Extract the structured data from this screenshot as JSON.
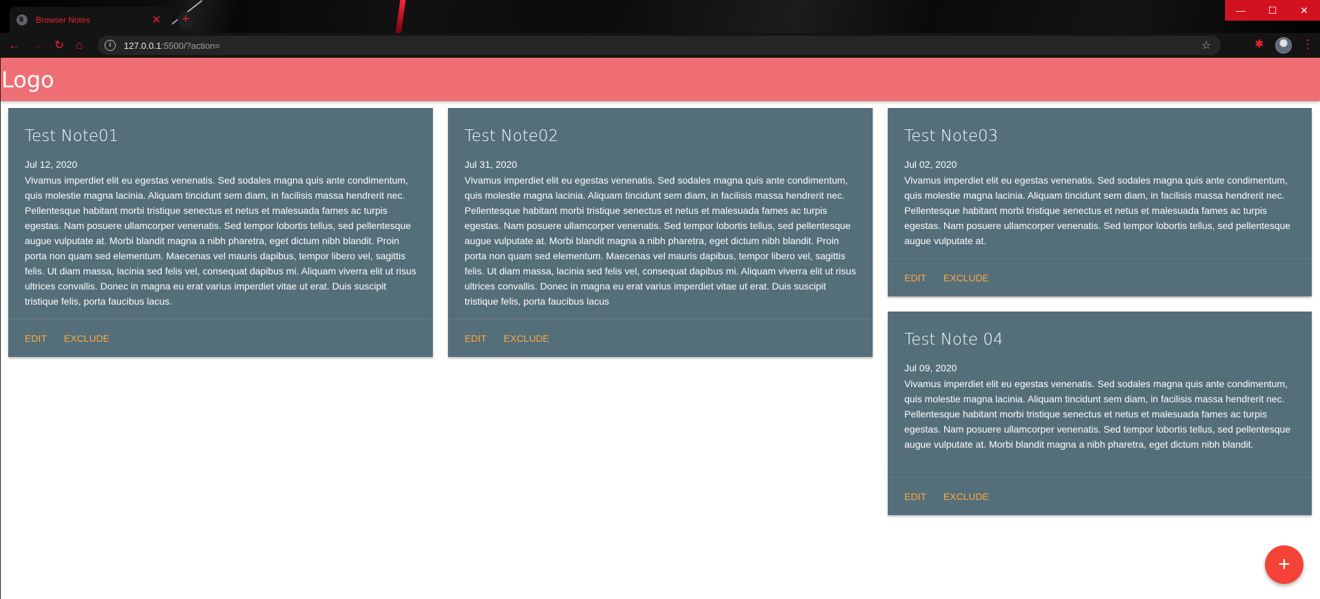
{
  "browser": {
    "tab_title": "Browser Notes",
    "tab_close": "✕",
    "new_tab": "+",
    "url_host": "127.0.0.1",
    "url_rest": ":5500/?action=",
    "window_controls": [
      "—",
      "☐",
      "✕"
    ]
  },
  "header": {
    "logo": "Logo"
  },
  "notes": [
    {
      "title": "Test Note01",
      "date": "Jul 12, 2020",
      "body": "Vivamus imperdiet elit eu egestas venenatis. Sed sodales magna quis ante condimentum, quis molestie magna lacinia. Aliquam tincidunt sem diam, in facilisis massa hendrerit nec. Pellentesque habitant morbi tristique senectus et netus et malesuada fames ac turpis egestas. Nam posuere ullamcorper venenatis. Sed tempor lobortis tellus, sed pellentesque augue vulputate at. Morbi blandit magna a nibh pharetra, eget dictum nibh blandit. Proin porta non quam sed elementum. Maecenas vel mauris dapibus, tempor libero vel, sagittis felis. Ut diam massa, lacinia sed felis vel, consequat dapibus mi. Aliquam viverra elit ut risus ultrices convallis. Donec in magna eu erat varius imperdiet vitae ut erat. Duis suscipit tristique felis, porta faucibus lacus.",
      "edit_label": "EDIT",
      "exclude_label": "EXCLUDE"
    },
    {
      "title": "Test Note02",
      "date": "Jul 31, 2020",
      "body": "Vivamus imperdiet elit eu egestas venenatis. Sed sodales magna quis ante condimentum, quis molestie magna lacinia. Aliquam tincidunt sem diam, in facilisis massa hendrerit nec. Pellentesque habitant morbi tristique senectus et netus et malesuada fames ac turpis egestas. Nam posuere ullamcorper venenatis. Sed tempor lobortis tellus, sed pellentesque augue vulputate at. Morbi blandit magna a nibh pharetra, eget dictum nibh blandit. Proin porta non quam sed elementum. Maecenas vel mauris dapibus, tempor libero vel, sagittis felis. Ut diam massa, lacinia sed felis vel, consequat dapibus mi. Aliquam viverra elit ut risus ultrices convallis. Donec in magna eu erat varius imperdiet vitae ut erat. Duis suscipit tristique felis, porta faucibus lacus",
      "edit_label": "EDIT",
      "exclude_label": "EXCLUDE"
    },
    {
      "title": "Test Note03",
      "date": "Jul 02, 2020",
      "body": "Vivamus imperdiet elit eu egestas venenatis. Sed sodales magna quis ante condimentum, quis molestie magna lacinia. Aliquam tincidunt sem diam, in facilisis massa hendrerit nec. Pellentesque habitant morbi tristique senectus et netus et malesuada fames ac turpis egestas. Nam posuere ullamcorper venenatis. Sed tempor lobortis tellus, sed pellentesque augue vulputate at.",
      "edit_label": "EDIT",
      "exclude_label": "EXCLUDE"
    },
    {
      "title": "Test Note 04",
      "date": "Jul 09, 2020",
      "body": "Vivamus imperdiet elit eu egestas venenatis. Sed sodales magna quis ante condimentum, quis molestie magna lacinia. Aliquam tincidunt sem diam, in facilisis massa hendrerit nec. Pellentesque habitant morbi tristique senectus et netus et malesuada fames ac turpis egestas. Nam posuere ullamcorper venenatis. Sed tempor lobortis tellus, sed pellentesque augue vulputate at. Morbi blandit magna a nibh pharetra, eget dictum nibh blandit.",
      "edit_label": "EDIT",
      "exclude_label": "EXCLUDE"
    }
  ],
  "fab": {
    "label": "+"
  },
  "colors": {
    "header": "#ef6f75",
    "card": "#546e7a",
    "action": "#ffab40",
    "fab": "#f44336",
    "browser_accent": "#e8242f"
  }
}
